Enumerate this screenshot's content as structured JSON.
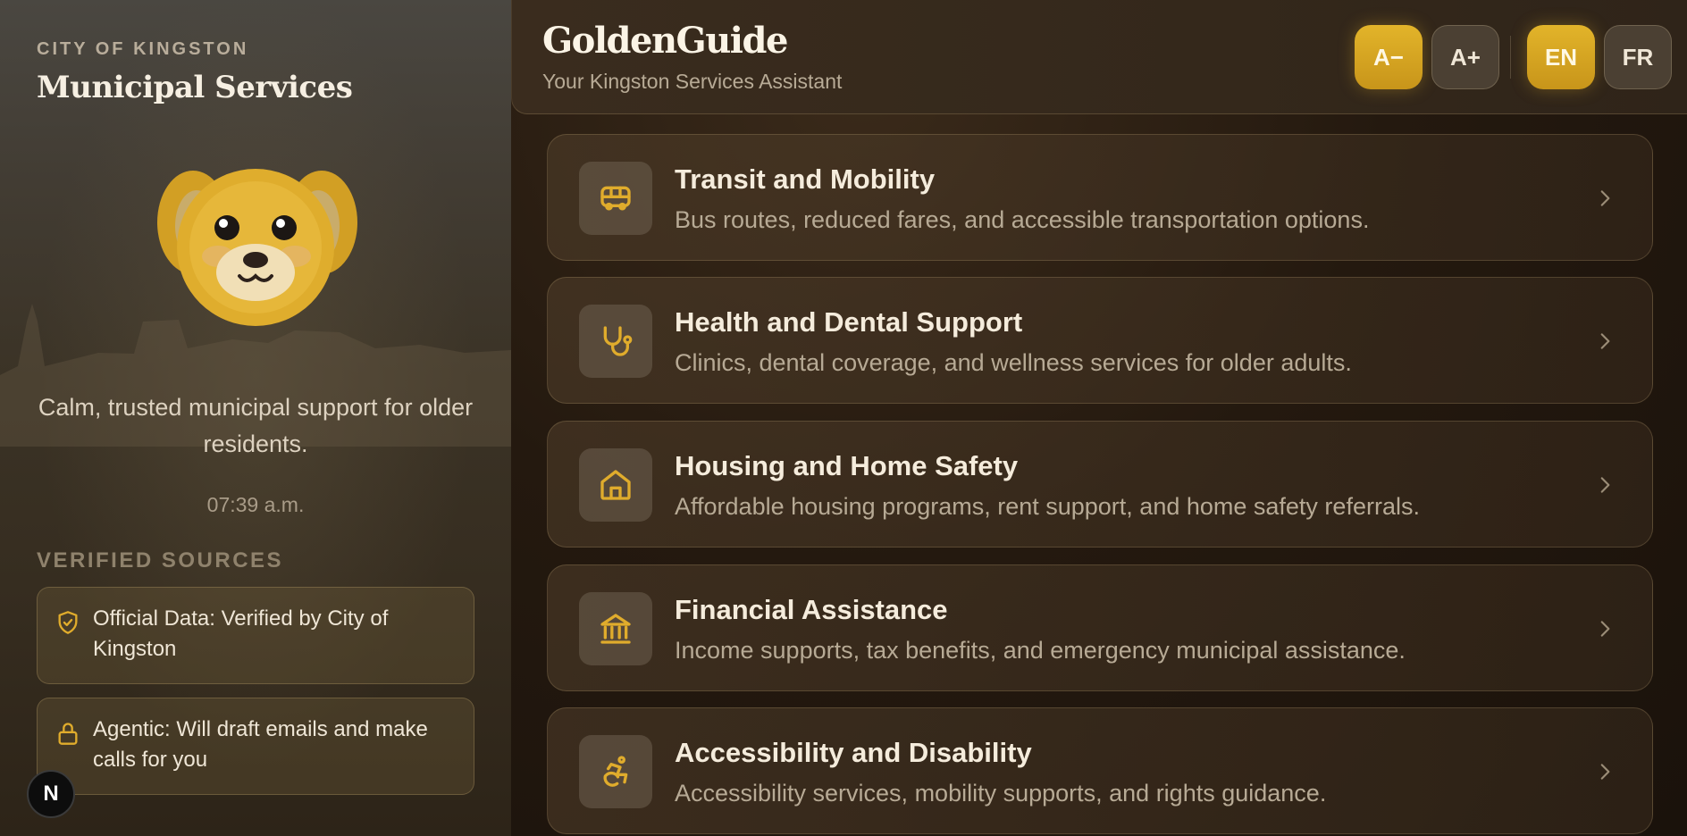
{
  "sidebar": {
    "city_label": "CITY OF KINGSTON",
    "title": "Municipal Services",
    "tagline": "Calm, trusted municipal support for older residents.",
    "time": "07:39 a.m.",
    "verified_heading": "VERIFIED SOURCES",
    "badges": [
      {
        "icon": "shield-check-icon",
        "text": "Official Data: Verified by City of Kingston"
      },
      {
        "icon": "lock-icon",
        "text": "Agentic: Will draft emails and make calls for you"
      }
    ],
    "dev_badge": "N"
  },
  "header": {
    "brand": "GoldenGuide",
    "subtitle": "Your Kingston Services Assistant",
    "font_decrease": "A−",
    "font_increase": "A+",
    "lang_en": "EN",
    "lang_fr": "FR"
  },
  "services": [
    {
      "icon": "bus-icon",
      "title": "Transit and Mobility",
      "desc": "Bus routes, reduced fares, and accessible transportation options."
    },
    {
      "icon": "stethoscope-icon",
      "title": "Health and Dental Support",
      "desc": "Clinics, dental coverage, and wellness services for older adults."
    },
    {
      "icon": "home-icon",
      "title": "Housing and Home Safety",
      "desc": "Affordable housing programs, rent support, and home safety referrals."
    },
    {
      "icon": "bank-icon",
      "title": "Financial Assistance",
      "desc": "Income supports, tax benefits, and emergency municipal assistance."
    },
    {
      "icon": "accessibility-icon",
      "title": "Accessibility and Disability",
      "desc": "Accessibility services, mobility supports, and rights guidance."
    }
  ],
  "colors": {
    "accent_gold": "#d6a628",
    "icon_gold": "#e0ac2c",
    "background": "#1b130c"
  }
}
